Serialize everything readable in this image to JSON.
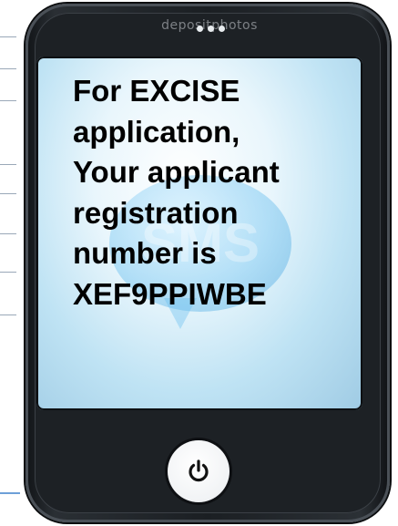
{
  "watermark": "depositphotos",
  "screen": {
    "background_word": "SMS",
    "message_lines": [
      "For EXCISE",
      "application,",
      "Your applicant",
      "registration",
      "number is",
      "XEF9PPIWBE"
    ]
  },
  "icons": {
    "power": "power-icon"
  },
  "colors": {
    "phone_body": "#1d2125",
    "screen_blue": "#bfe3f4",
    "text": "#000000",
    "guide_lines": "#9aa8b8",
    "accent_line": "#6ea0d8"
  }
}
